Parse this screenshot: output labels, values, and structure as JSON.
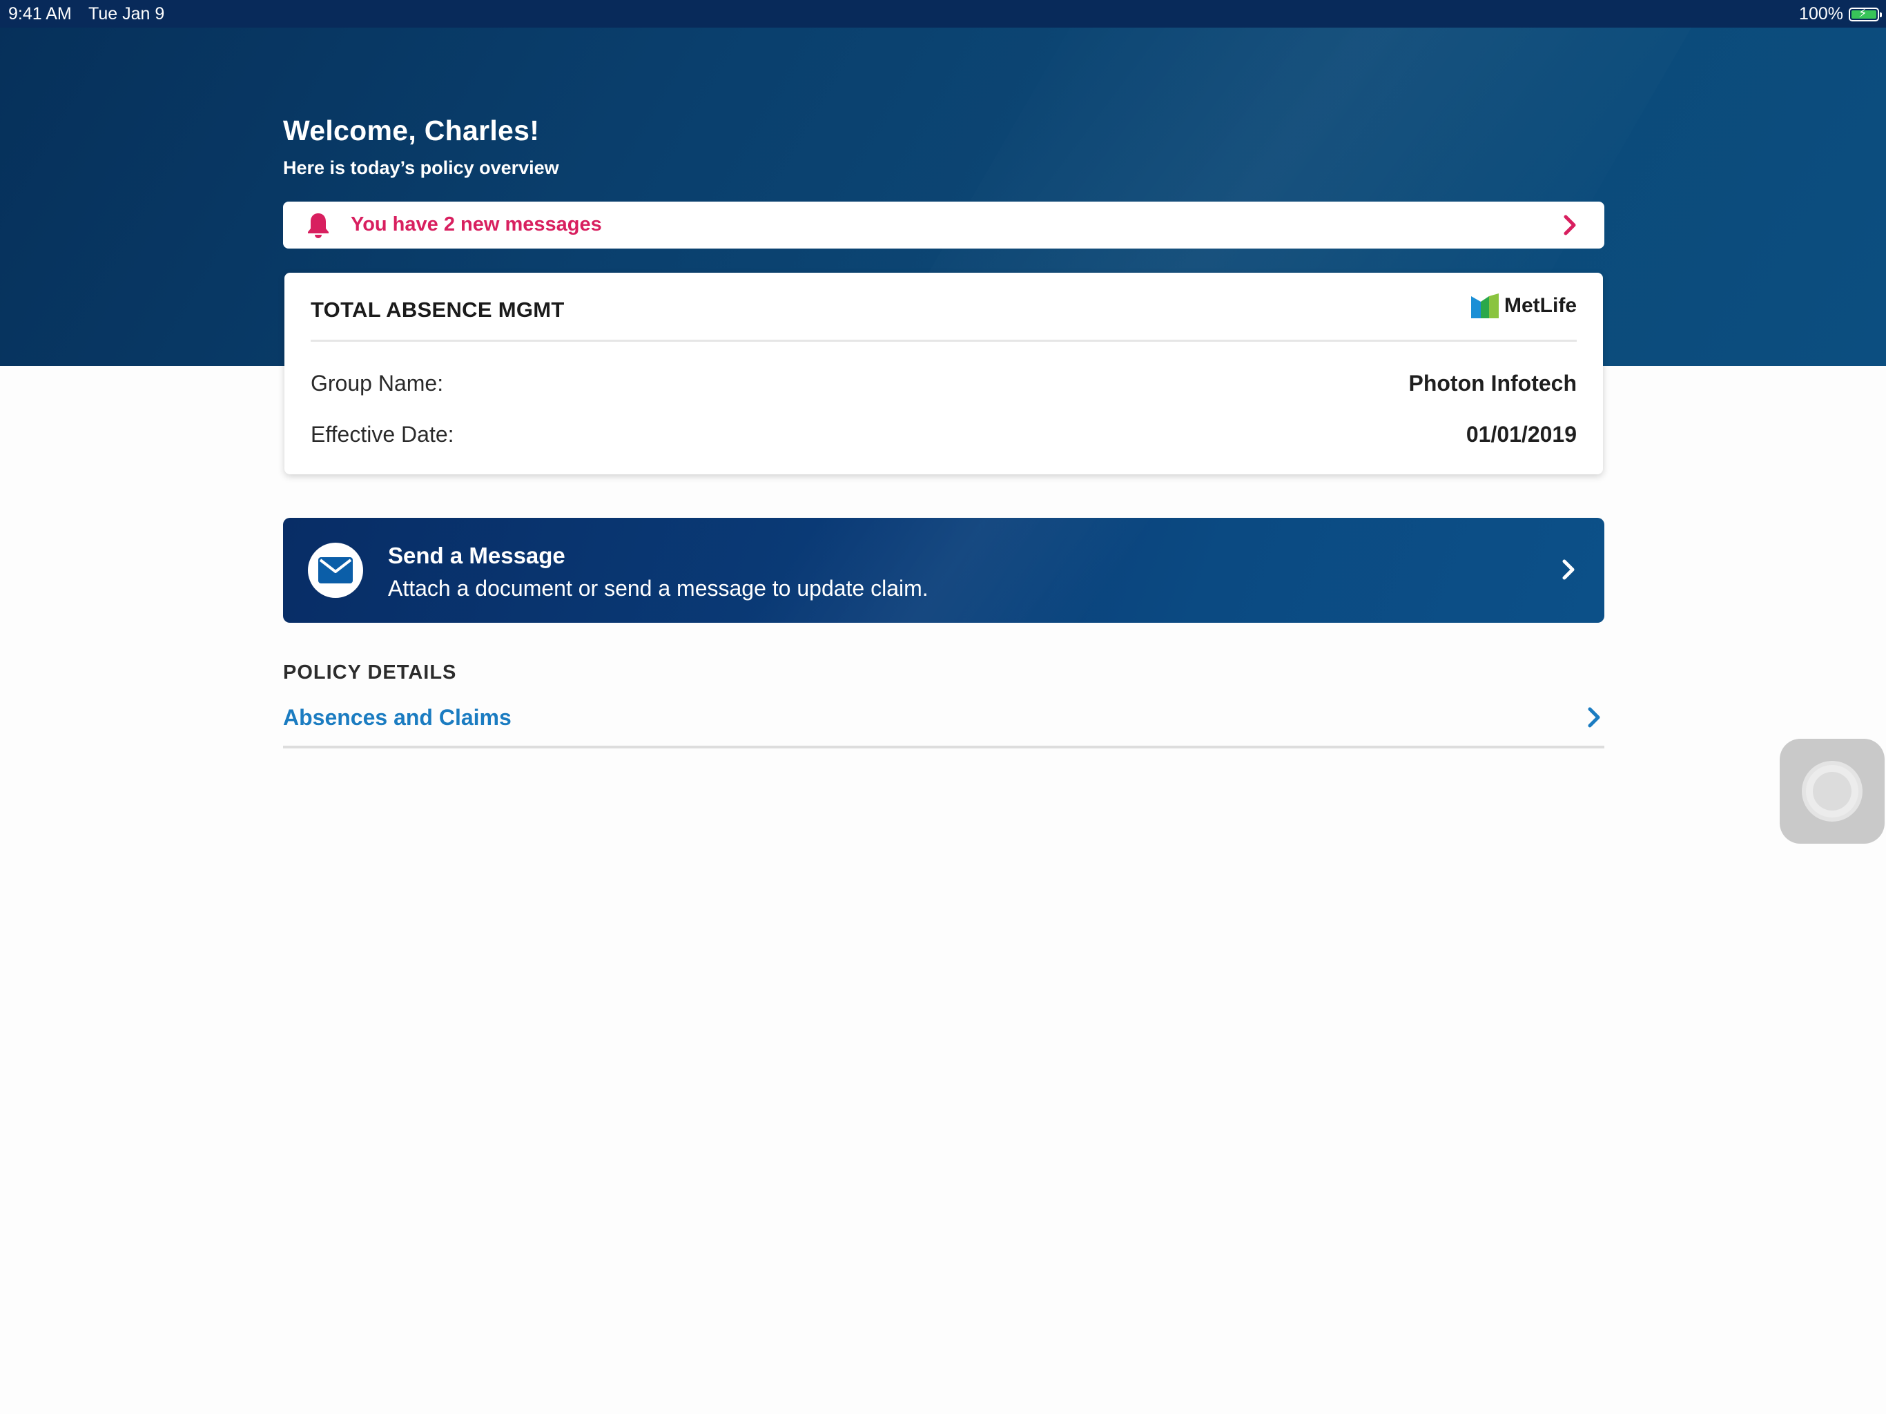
{
  "status_bar": {
    "time": "9:41 AM",
    "date": "Tue Jan 9",
    "battery_percent": "100%",
    "battery_level": 1.0,
    "battery_icon": "charging-battery-icon"
  },
  "header": {
    "welcome": "Welcome, Charles!",
    "subtitle": "Here is today’s policy overview"
  },
  "messages_banner": {
    "text": "You have 2 new messages",
    "icon": "bell-icon",
    "color": "#d81f5f"
  },
  "policy_card": {
    "title": "TOTAL ABSENCE MGMT",
    "brand": "MetLife",
    "rows": [
      {
        "label": "Group Name:",
        "value": "Photon Infotech"
      },
      {
        "label": "Effective Date:",
        "value": "01/01/2019"
      }
    ]
  },
  "send_message": {
    "title": "Send a Message",
    "subtitle": "Attach a document or send a message to update claim.",
    "icon": "mail-icon"
  },
  "policy_details": {
    "heading": "POLICY DETAILS",
    "items": [
      {
        "label": "Absences and Claims",
        "color": "#1b7cc1"
      }
    ]
  },
  "colors": {
    "header_navy": "#06305a",
    "accent_blue": "#1b7cc1",
    "alert_pink": "#d81f5f",
    "metlife_green": "#8ac43f",
    "metlife_blue": "#1a8fd6"
  }
}
